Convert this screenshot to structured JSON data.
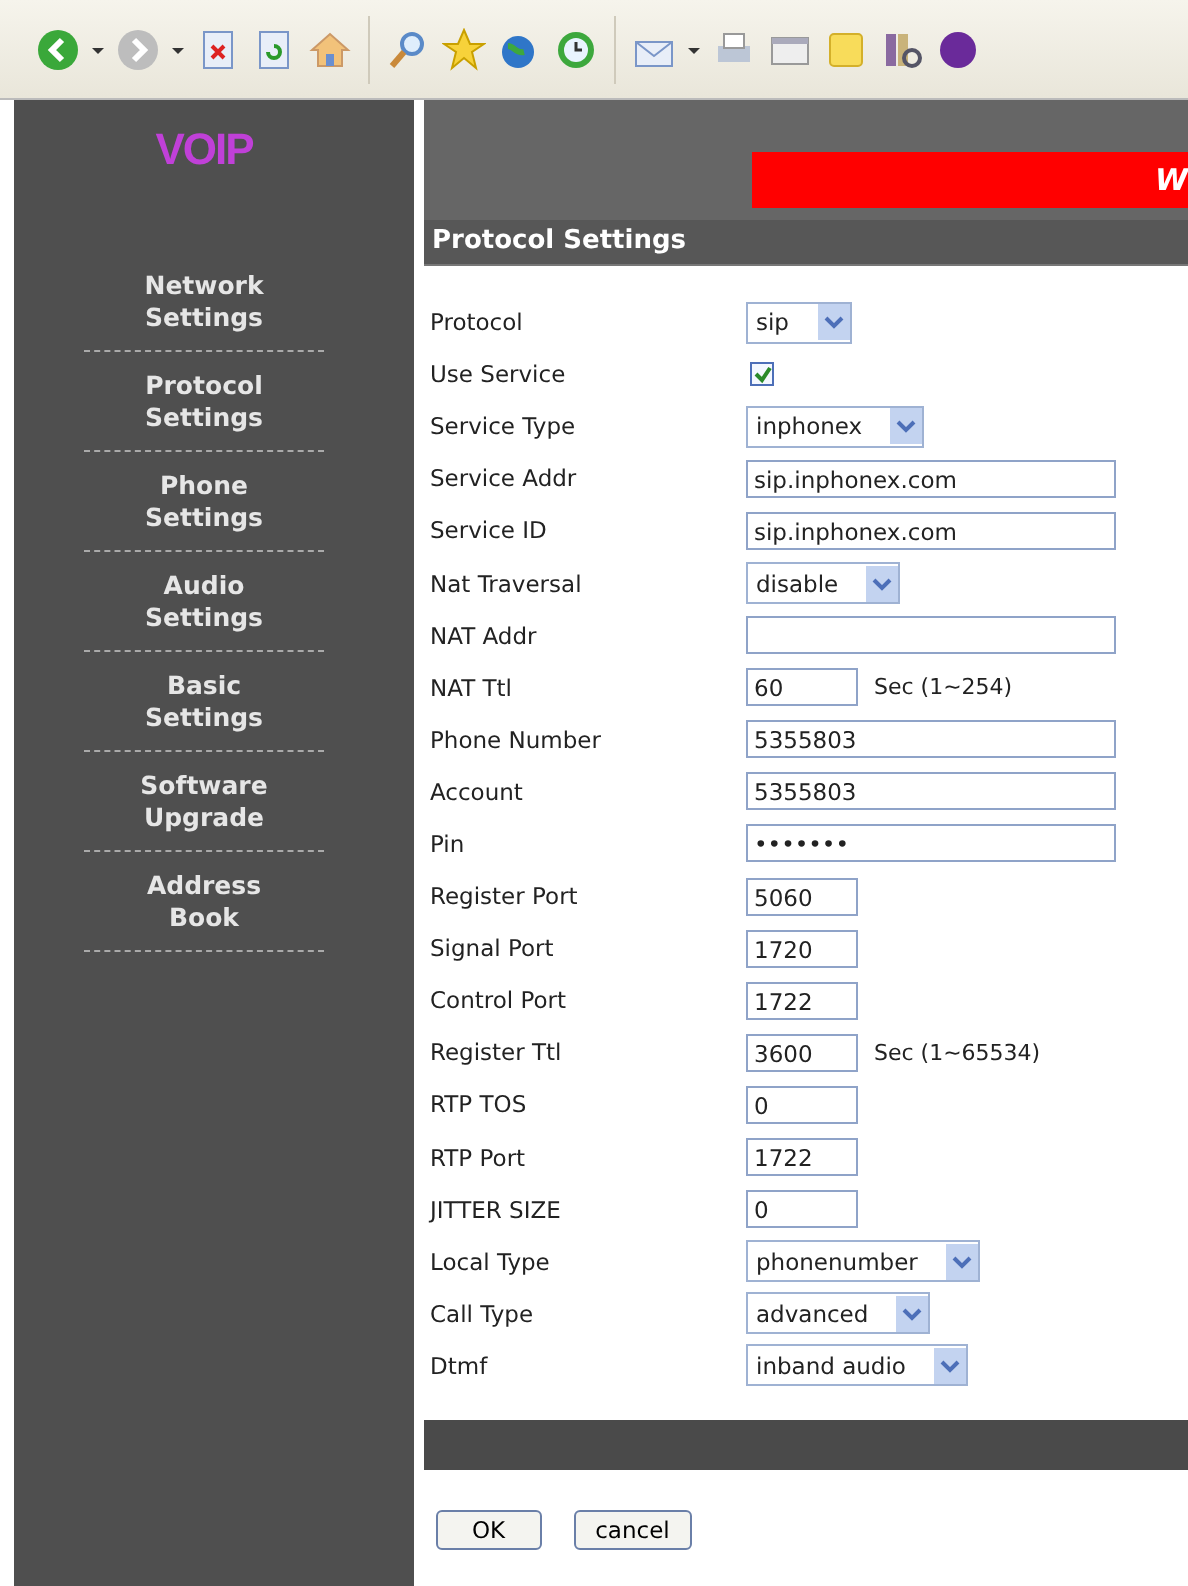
{
  "sidebar": {
    "logo": "VOIP",
    "items": [
      {
        "lines": [
          "Network",
          "Settings"
        ]
      },
      {
        "lines": [
          "Protocol",
          "Settings"
        ]
      },
      {
        "lines": [
          "Phone",
          "Settings"
        ]
      },
      {
        "lines": [
          "Audio",
          "Settings"
        ]
      },
      {
        "lines": [
          "Basic",
          "Settings"
        ]
      },
      {
        "lines": [
          "Software",
          "Upgrade"
        ]
      },
      {
        "lines": [
          "Address",
          "Book"
        ]
      }
    ]
  },
  "banner": {
    "text": "W"
  },
  "form": {
    "title": "Protocol Settings",
    "rows": [
      {
        "label": "Protocol",
        "kind": "select",
        "value": "sip"
      },
      {
        "label": "Use Service",
        "kind": "checkbox",
        "checked": true
      },
      {
        "label": "Service Type",
        "kind": "select",
        "value": "inphonex"
      },
      {
        "label": "Service Addr",
        "kind": "long",
        "value": "sip.inphonex.com"
      },
      {
        "label": "Service ID",
        "kind": "long",
        "value": "sip.inphonex.com"
      },
      {
        "label": "Nat Traversal",
        "kind": "select",
        "value": "disable"
      },
      {
        "label": "NAT Addr",
        "kind": "long"
      },
      {
        "label": "NAT Ttl",
        "kind": "short",
        "value": "60",
        "hint": "Sec (1~254)"
      },
      {
        "label": "Phone Number",
        "kind": "long",
        "value": "5355803"
      },
      {
        "label": "Account",
        "kind": "long",
        "value": "5355803"
      },
      {
        "label": "Pin",
        "kind": "long",
        "value": "•••••••"
      },
      {
        "label": "Register Port",
        "kind": "short",
        "value": "5060"
      },
      {
        "label": "Signal Port",
        "kind": "short",
        "value": "1720"
      },
      {
        "label": "Control Port",
        "kind": "short",
        "value": "1722"
      },
      {
        "label": "Register Ttl",
        "kind": "short",
        "value": "3600",
        "hint": "Sec (1~65534)"
      },
      {
        "label": "RTP TOS",
        "kind": "short",
        "value": "0"
      },
      {
        "label": "RTP Port",
        "kind": "short",
        "value": "1722"
      },
      {
        "label": "JITTER SIZE",
        "kind": "short",
        "value": "0"
      },
      {
        "label": "Local Type",
        "kind": "select",
        "value": "phonenumber"
      },
      {
        "label": "Call Type",
        "kind": "select",
        "value": "advanced"
      },
      {
        "label": "Dtmf",
        "kind": "select",
        "value": "inband audio"
      }
    ],
    "buttons": [
      "OK",
      "cancel"
    ]
  }
}
